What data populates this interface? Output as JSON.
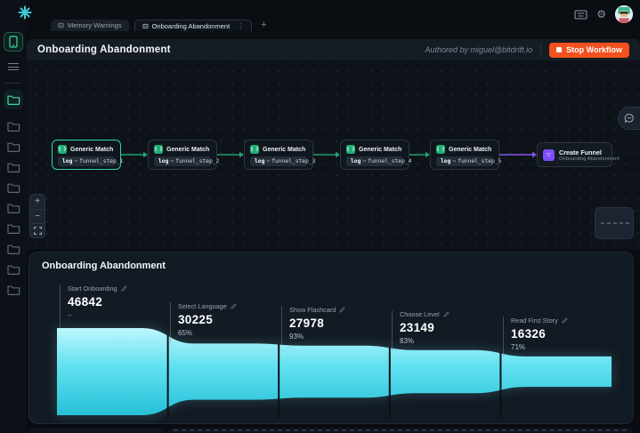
{
  "topbar": {
    "tabs": [
      {
        "label": "Memory Warnings"
      },
      {
        "label": "Onboarding Abandonment"
      }
    ],
    "tab_menu": "⋮",
    "new_tab": "+"
  },
  "header": {
    "title": "Onboarding Abandonment",
    "authored_by": "Authored by miguel@bitdrift.io",
    "stop_button": "Stop Workflow"
  },
  "canvas": {
    "zoom_in": "+",
    "zoom_out": "−",
    "node_icon_glyph": "{ }",
    "create_icon_glyph": "▽",
    "nodes": [
      {
        "title": "Generic Match",
        "log_key": "log",
        "eq": "=",
        "log_value": "funnel_step_1"
      },
      {
        "title": "Generic Match",
        "log_key": "log",
        "eq": "=",
        "log_value": "funnel_step_2"
      },
      {
        "title": "Generic Match",
        "log_key": "log",
        "eq": "=",
        "log_value": "funnel_step_3"
      },
      {
        "title": "Generic Match",
        "log_key": "log",
        "eq": "=",
        "log_value": "funnel_step_4"
      },
      {
        "title": "Generic Match",
        "log_key": "log",
        "eq": "=",
        "log_value": "funnel_step_5"
      }
    ],
    "create_node": {
      "title": "Create Funnel",
      "subtitle": "Onboarding Abandonment"
    }
  },
  "funnel": {
    "title": "Onboarding Abandonment",
    "stages": [
      {
        "label": "Start Onboarding",
        "value": "46842",
        "pct": "–"
      },
      {
        "label": "Select Language",
        "value": "30225",
        "pct": "65%"
      },
      {
        "label": "Show Flashcard",
        "value": "27978",
        "pct": "93%"
      },
      {
        "label": "Choose Level",
        "value": "23149",
        "pct": "83%"
      },
      {
        "label": "Read First Story",
        "value": "16326",
        "pct": "71%"
      }
    ]
  },
  "chart_data": {
    "type": "area",
    "title": "Onboarding Abandonment",
    "categories": [
      "Start Onboarding",
      "Select Language",
      "Show Flashcard",
      "Choose Level",
      "Read First Story"
    ],
    "values": [
      46842,
      30225,
      27978,
      23149,
      16326
    ],
    "pct_of_previous": [
      null,
      65,
      93,
      83,
      71
    ],
    "colors": {
      "funnel_top": "#bdf6fd",
      "funnel_bottom": "#27c0d8"
    }
  },
  "colors": {
    "edge_green": "#27a06b",
    "edge_purple": "#8655f0",
    "stop_orange": "#f4511e",
    "active_teal": "#2ed3a5"
  }
}
